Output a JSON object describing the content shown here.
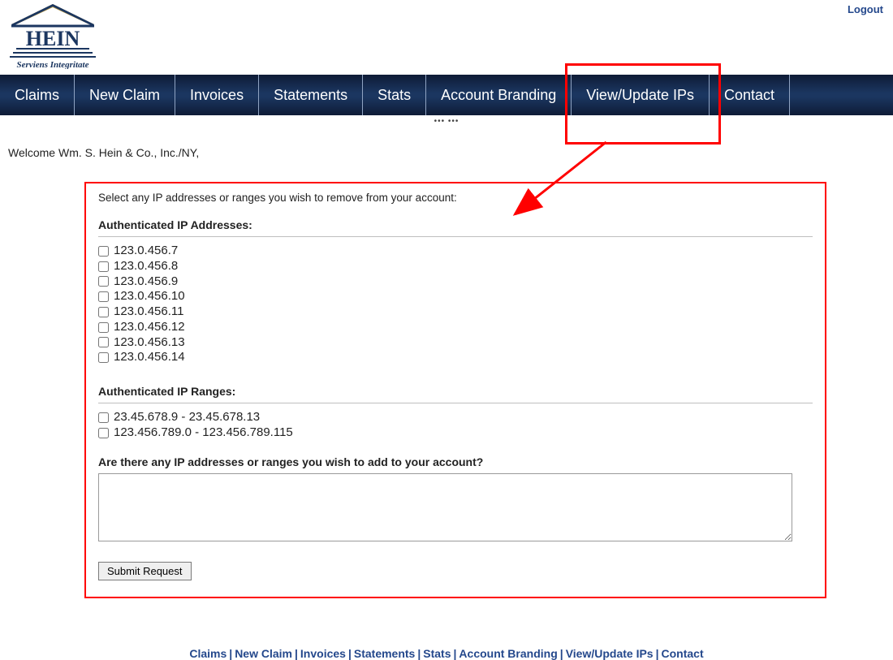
{
  "top_right": {
    "logout": "Logout"
  },
  "logo": {
    "brand_main": "HEIN",
    "brand_tag": "Serviens Integritate"
  },
  "nav": {
    "items": [
      "Claims",
      "New Claim",
      "Invoices",
      "Statements",
      "Stats",
      "Account Branding",
      "View/Update IPs",
      "Contact"
    ],
    "highlight_index": 6
  },
  "welcome": "Welcome Wm. S. Hein & Co., Inc./NY,",
  "panel": {
    "intro": "Select any IP addresses or ranges you wish to remove from your account:",
    "auth_ips_title": "Authenticated IP Addresses:",
    "auth_ips": [
      "123.0.456.7",
      "123.0.456.8",
      "123.0.456.9",
      "123.0.456.10",
      "123.0.456.11",
      "123.0.456.12",
      "123.0.456.13",
      "123.0.456.14"
    ],
    "auth_ranges_title": "Authenticated IP Ranges:",
    "auth_ranges": [
      "23.45.678.9 - 23.45.678.13",
      "123.456.789.0 - 123.456.789.115"
    ],
    "add_question": "Are there any IP addresses or ranges you wish to add to your account?",
    "textarea_value": "",
    "submit_label": "Submit Request"
  },
  "footer": {
    "links": [
      "Claims",
      "New Claim",
      "Invoices",
      "Statements",
      "Stats",
      "Account Branding",
      "View/Update IPs",
      "Contact"
    ]
  },
  "colors": {
    "accent": "#24488c",
    "highlight": "#ff0000"
  }
}
